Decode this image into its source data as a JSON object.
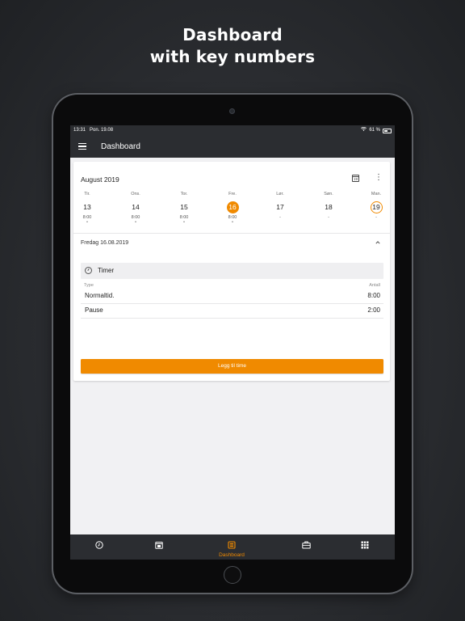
{
  "promo": {
    "line1": "Dashboard",
    "line2": "with key numbers"
  },
  "status": {
    "time": "13:31",
    "date": "Pon. 19.08",
    "battery": "61 %"
  },
  "appbar": {
    "title": "Dashboard"
  },
  "calendar": {
    "month": "August 2019",
    "days": [
      {
        "name": "Tir.",
        "num": "13",
        "hours": "8:00",
        "dot": "•"
      },
      {
        "name": "Ons.",
        "num": "14",
        "hours": "8:00",
        "dot": "•"
      },
      {
        "name": "Tor.",
        "num": "15",
        "hours": "8:00",
        "dot": "•"
      },
      {
        "name": "Fre.",
        "num": "16",
        "hours": "8:00",
        "dot": "•"
      },
      {
        "name": "Lør.",
        "num": "17",
        "hours": "-",
        "dot": ""
      },
      {
        "name": "Søn.",
        "num": "18",
        "hours": "-",
        "dot": ""
      },
      {
        "name": "Man.",
        "num": "19",
        "hours": "-",
        "dot": ""
      }
    ]
  },
  "detail": {
    "date": "Fredag 16.08.2019",
    "section_label": "Timer",
    "col_type": "Type",
    "col_count": "Antall",
    "rows": [
      {
        "label": "Normaltid.",
        "value": "8:00"
      },
      {
        "label": "Pause",
        "value": "2:00"
      }
    ],
    "add_button": "Legg til time"
  },
  "bottomnav": {
    "active_label": "Dashboard"
  },
  "colors": {
    "accent": "#f08a00",
    "appbar": "#2b2d31",
    "content_bg": "#f1f1f3"
  }
}
